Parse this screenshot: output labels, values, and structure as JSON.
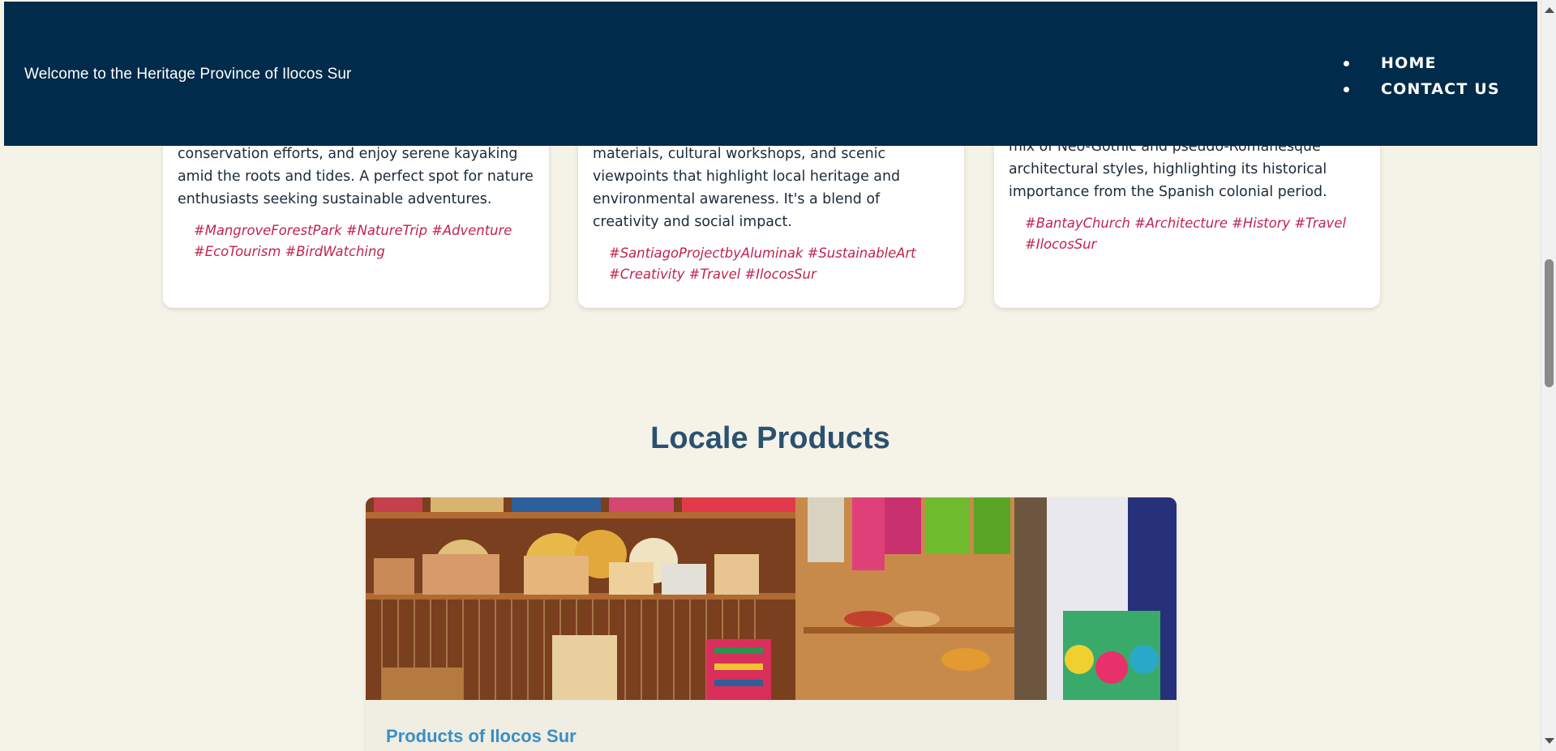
{
  "header": {
    "title": "Welcome to the Heritage Province of Ilocos Sur",
    "nav": [
      {
        "label": "HOME"
      },
      {
        "label": "CONTACT US"
      }
    ]
  },
  "cards": [
    {
      "text": "conservation efforts, and enjoy serene kayaking amid the roots and tides. A perfect spot for nature enthusiasts seeking sustainable adventures.",
      "tags": "#MangroveForestPark #NatureTrip #Adventure #EcoTourism #BirdWatching"
    },
    {
      "text": "materials, cultural workshops, and scenic viewpoints that highlight local heritage and environmental awareness. It's a blend of creativity and social impact.",
      "tags": "#SantiagoProjectbyAluminak #SustainableArt #Creativity #Travel #IlocosSur"
    },
    {
      "text": "mix of Neo-Gothic and pseudo-Romanesque architectural styles, highlighting its historical importance from the Spanish colonial period.",
      "tags": "#BantayChurch #Architecture #History #Travel #IlocosSur"
    }
  ],
  "section": {
    "title": "Locale Products"
  },
  "product": {
    "title": "Products of Ilocos Sur",
    "image_icon": "handicrafts-photo"
  },
  "colors": {
    "header_bg": "#002b4a",
    "page_bg": "#f5f2e8",
    "tag": "#c0244e",
    "section_title": "#2b5170",
    "product_title": "#3a8fc4"
  }
}
